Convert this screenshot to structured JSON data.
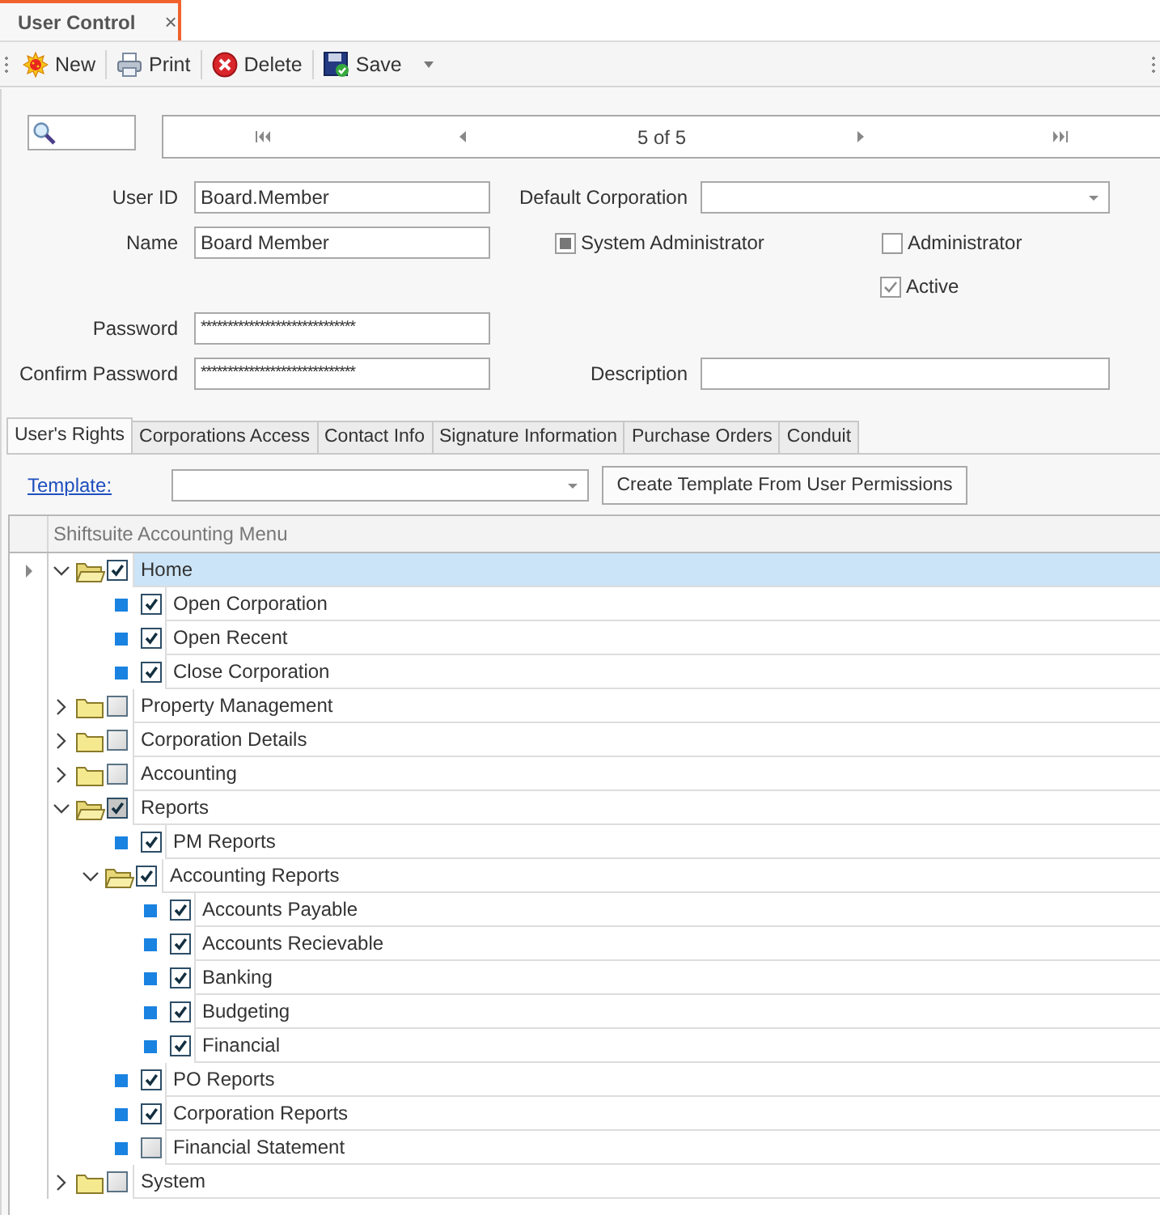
{
  "document_tab": {
    "title": "User Control",
    "close": "×"
  },
  "toolbar": [
    {
      "kind": "new",
      "label": "New"
    },
    {
      "kind": "print",
      "label": "Print"
    },
    {
      "kind": "delete",
      "label": "Delete"
    },
    {
      "kind": "save",
      "label": "Save",
      "dropdown": true
    }
  ],
  "navigator": {
    "position": "5 of 5"
  },
  "form": {
    "user_id": {
      "label": "User ID",
      "value": "Board.Member"
    },
    "name": {
      "label": "Name",
      "value": "Board Member"
    },
    "password": {
      "label": "Password",
      "value": "*****************************"
    },
    "confirm_password": {
      "label": "Confirm Password",
      "value": "*****************************"
    },
    "default_corporation": {
      "label": "Default Corporation"
    },
    "description": {
      "label": "Description"
    },
    "system_administrator": {
      "label": "System Administrator",
      "checked": false,
      "mixed": true
    },
    "administrator": {
      "label": "Administrator",
      "checked": false,
      "mixed": false
    },
    "active": {
      "label": "Active",
      "checked": true,
      "mixed": false
    }
  },
  "tabs": [
    {
      "label": "User's Rights",
      "selected": true
    },
    {
      "label": "Corporations Access",
      "selected": false
    },
    {
      "label": "Contact Info",
      "selected": false
    },
    {
      "label": "Signature Information",
      "selected": false
    },
    {
      "label": "Purchase Orders",
      "selected": false
    },
    {
      "label": "Conduit",
      "selected": false
    }
  ],
  "template": {
    "label": "Template:",
    "button": "Create Template From User Permissions"
  },
  "tree": {
    "column": "Shiftsuite Accounting Menu",
    "nodes": [
      {
        "kind": "folder",
        "label": "Home",
        "checked": true,
        "mixed": false,
        "expanded": true,
        "selected": true,
        "children": [
          {
            "kind": "item",
            "label": "Open Corporation",
            "checked": true,
            "mixed": false,
            "selected": false
          },
          {
            "kind": "item",
            "label": "Open Recent",
            "checked": true,
            "mixed": false,
            "selected": false
          },
          {
            "kind": "item",
            "label": "Close Corporation",
            "checked": true,
            "mixed": false,
            "selected": false
          }
        ]
      },
      {
        "kind": "folder",
        "label": "Property Management",
        "checked": false,
        "mixed": false,
        "expanded": false,
        "selected": false
      },
      {
        "kind": "folder",
        "label": "Corporation Details",
        "checked": false,
        "mixed": false,
        "expanded": false,
        "selected": false
      },
      {
        "kind": "folder",
        "label": "Accounting",
        "checked": false,
        "mixed": false,
        "expanded": false,
        "selected": false
      },
      {
        "kind": "folder",
        "label": "Reports",
        "checked": true,
        "mixed": true,
        "expanded": true,
        "selected": false,
        "children": [
          {
            "kind": "item",
            "label": "PM Reports",
            "checked": true,
            "mixed": false,
            "selected": false
          },
          {
            "kind": "folder",
            "label": "Accounting Reports",
            "checked": true,
            "mixed": false,
            "expanded": true,
            "selected": false,
            "children": [
              {
                "kind": "item",
                "label": "Accounts Payable",
                "checked": true,
                "mixed": false,
                "selected": false
              },
              {
                "kind": "item",
                "label": "Accounts Recievable",
                "checked": true,
                "mixed": false,
                "selected": false
              },
              {
                "kind": "item",
                "label": "Banking",
                "checked": true,
                "mixed": false,
                "selected": false
              },
              {
                "kind": "item",
                "label": "Budgeting",
                "checked": true,
                "mixed": false,
                "selected": false
              },
              {
                "kind": "item",
                "label": "Financial",
                "checked": true,
                "mixed": false,
                "selected": false
              }
            ]
          },
          {
            "kind": "item",
            "label": "PO Reports",
            "checked": true,
            "mixed": false,
            "selected": false
          },
          {
            "kind": "item",
            "label": "Corporation Reports",
            "checked": true,
            "mixed": false,
            "selected": false
          },
          {
            "kind": "item",
            "label": "Financial Statement",
            "checked": false,
            "mixed": false,
            "selected": false
          }
        ]
      },
      {
        "kind": "folder",
        "label": "System",
        "checked": false,
        "mixed": false,
        "expanded": false,
        "selected": false
      }
    ]
  }
}
